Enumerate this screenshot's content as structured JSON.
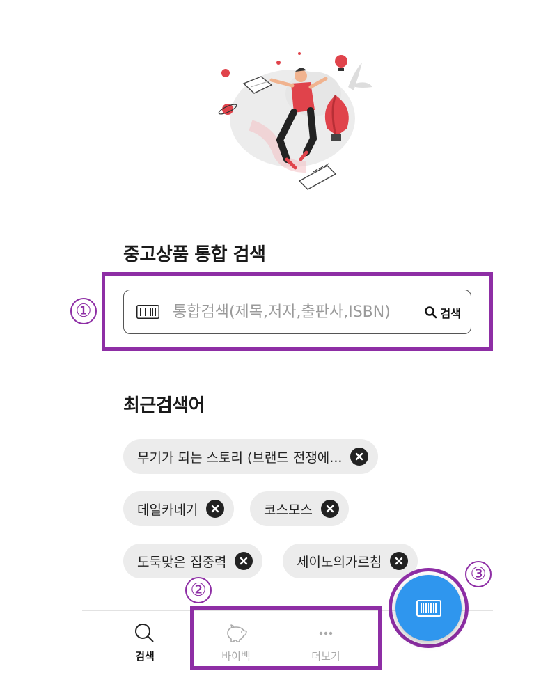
{
  "search_section": {
    "title": "중고상품 통합 검색",
    "placeholder": "통합검색(제목,저자,출판사,ISBN)",
    "search_button_label": "검색"
  },
  "recent_section": {
    "title": "최근검색어",
    "chips": [
      {
        "label": "무기가 되는 스토리 (브랜드 전쟁에..."
      },
      {
        "label": "데일카네기"
      },
      {
        "label": "코스모스"
      },
      {
        "label": "도둑맞은 집중력"
      },
      {
        "label": "세이노의가르침"
      }
    ]
  },
  "bottom_nav": {
    "items": [
      {
        "label": "검색",
        "icon": "search-icon",
        "active": true
      },
      {
        "label": "바이백",
        "icon": "piggy-bank-icon",
        "active": false
      },
      {
        "label": "더보기",
        "icon": "more-dots-icon",
        "active": false
      }
    ]
  },
  "fab": {
    "icon": "barcode-icon"
  },
  "annotations": {
    "marker_1": "①",
    "marker_2": "②",
    "marker_3": "③"
  },
  "colors": {
    "accent": "#2f96ee",
    "annotation": "#8e2ea5",
    "chip_bg": "#ececec"
  }
}
